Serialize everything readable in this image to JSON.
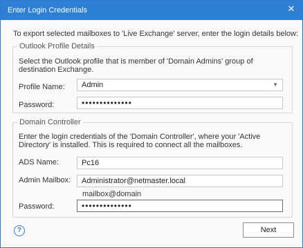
{
  "window": {
    "title": "Enter Login Credentials",
    "close_icon": "close-icon"
  },
  "intro_text": "To export selected mailboxes to 'Live Exchange' server, enter the login details below:",
  "outlook_profile": {
    "legend": "Outlook Profile Details",
    "description": "Select the Outlook profile that is member of 'Domain Admins' group of destination Exchange.",
    "profile_name_label": "Profile Name:",
    "profile_name_value": "Admin",
    "dropdown_icon": "chevron-down-icon",
    "password_label": "Password:",
    "password_value": "••••••••••••••"
  },
  "domain_controller": {
    "legend": "Domain Controller",
    "description": "Enter the login credentials of the 'Domain Controller', where your 'Active Directory' is installed. This is required to connect all the mailboxes.",
    "ads_name_label": "ADS Name:",
    "ads_name_value": "Pc16",
    "admin_mailbox_label": "Admin Mailbox:",
    "admin_mailbox_value": "Administrator@netmaster.local",
    "mailbox_hint": "mailbox@domain",
    "password_label": "Password:",
    "password_value": "••••••••••••••"
  },
  "footer": {
    "help_icon": "help-icon",
    "help_glyph": "?",
    "next_label": "Next"
  },
  "colors": {
    "title_bar": "#2e7fd6",
    "help_icon": "#2e7fd6"
  }
}
